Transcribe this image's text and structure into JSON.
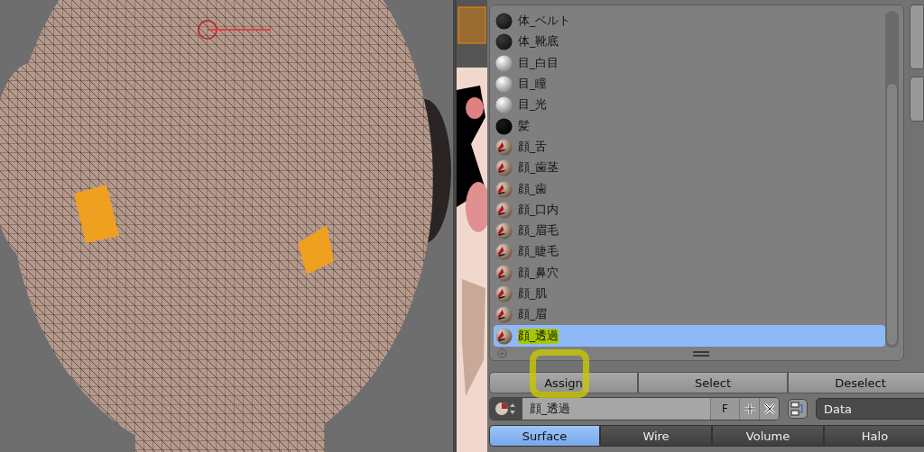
{
  "materials": [
    {
      "name": "体_ベルト",
      "kind": "dark",
      "selected": false
    },
    {
      "name": "体_靴底",
      "kind": "dark",
      "selected": false
    },
    {
      "name": "目_白目",
      "kind": "white",
      "selected": false
    },
    {
      "name": "目_瞳",
      "kind": "white",
      "selected": false
    },
    {
      "name": "目_光",
      "kind": "white",
      "selected": false
    },
    {
      "name": "髪",
      "kind": "black",
      "selected": false
    },
    {
      "name": "顔_舌",
      "kind": "skin",
      "selected": false
    },
    {
      "name": "顔_歯茎",
      "kind": "skin",
      "selected": false
    },
    {
      "name": "顔_歯",
      "kind": "skin",
      "selected": false
    },
    {
      "name": "顔_口内",
      "kind": "skin",
      "selected": false
    },
    {
      "name": "顔_眉毛",
      "kind": "skin",
      "selected": false
    },
    {
      "name": "顔_睫毛",
      "kind": "skin",
      "selected": false
    },
    {
      "name": "顔_鼻穴",
      "kind": "skin",
      "selected": false
    },
    {
      "name": "顔_肌",
      "kind": "skin",
      "selected": false
    },
    {
      "name": "顔_眉",
      "kind": "skin",
      "selected": false
    },
    {
      "name": "顔_透過",
      "kind": "skin",
      "selected": true
    }
  ],
  "actions": [
    "Assign",
    "Select",
    "Deselect"
  ],
  "material_field": {
    "value": "顔_透過",
    "fake_user": "F",
    "link": "Data"
  },
  "tabs": [
    {
      "label": "Surface",
      "selected": true
    },
    {
      "label": "Wire",
      "selected": false
    },
    {
      "label": "Volume",
      "selected": false
    },
    {
      "label": "Halo",
      "selected": false
    }
  ]
}
